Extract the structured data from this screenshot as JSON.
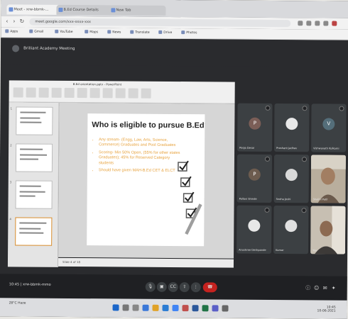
{
  "browser": {
    "tabs": [
      {
        "label": "Meet - xrw-bbmk-..."
      },
      {
        "label": "B.Ed Course Details"
      },
      {
        "label": "New Tab"
      }
    ],
    "url": "meet.google.com/xxx-xxxx-xxx",
    "bookmarks": [
      "Apps",
      "Gmail",
      "YouTube",
      "Maps",
      "News",
      "Translate",
      "Drive",
      "Photos"
    ]
  },
  "meeting": {
    "title": "Brilliant Academy Meeting",
    "clock": "10:45",
    "code": "xrw-bbmk-mmo"
  },
  "presentation": {
    "window_title": "B.Ed orientation.pptx - PowerPoint",
    "slide_title": "Who is eligible to pursue B.Ed?",
    "bullets": [
      "Any stream- (Engg, Law, Arts, Science, Commerce) Graduates and Post Graduates",
      "Scoring- Min 50% Open, (55% for other states Graduates); 45% for Reserved Category students",
      "Should have given MAH-B.Ed CET & ELCT"
    ],
    "status": "Slide 4 of 18",
    "thumb_numbers": [
      "1",
      "2",
      "3",
      "4"
    ]
  },
  "participants": [
    {
      "initial": "P",
      "name": "Pooja Desai",
      "color": "#7b5e57",
      "video": false
    },
    {
      "initial": "",
      "name": "Prashant Jadhav",
      "color": "#5f6368",
      "video": false
    },
    {
      "initial": "V",
      "name": "Vishwanath Kulkarni",
      "color": "#546e7a",
      "video": false
    },
    {
      "initial": "P",
      "name": "Pallavi Shinde",
      "color": "#6d5c4f",
      "video": false
    },
    {
      "initial": "",
      "name": "Sneha Joshi",
      "color": "#4a4f55",
      "video": false
    },
    {
      "initial": "",
      "name": "Shalini Patil",
      "color": "#8d8376",
      "video": true
    },
    {
      "initial": "",
      "name": "Anushree Deshpande",
      "color": "#5f6368",
      "video": false
    },
    {
      "initial": "",
      "name": "Kumar",
      "color": "#4a4f55",
      "video": false
    },
    {
      "initial": "",
      "name": "You",
      "color": "#9a8a78",
      "video": true
    }
  ],
  "controls": [
    "mic",
    "camera",
    "captions",
    "present",
    "more",
    "end-call"
  ],
  "right_controls": [
    "info",
    "people",
    "chat",
    "activities"
  ],
  "taskbar": {
    "weather": "28°C\nHaze",
    "time": "10:45",
    "date": "10-06-2021"
  },
  "colors": {
    "bullet_text": "#e7a33f",
    "end_call": "#c5221f",
    "meet_bg": "#2a2b2e"
  }
}
